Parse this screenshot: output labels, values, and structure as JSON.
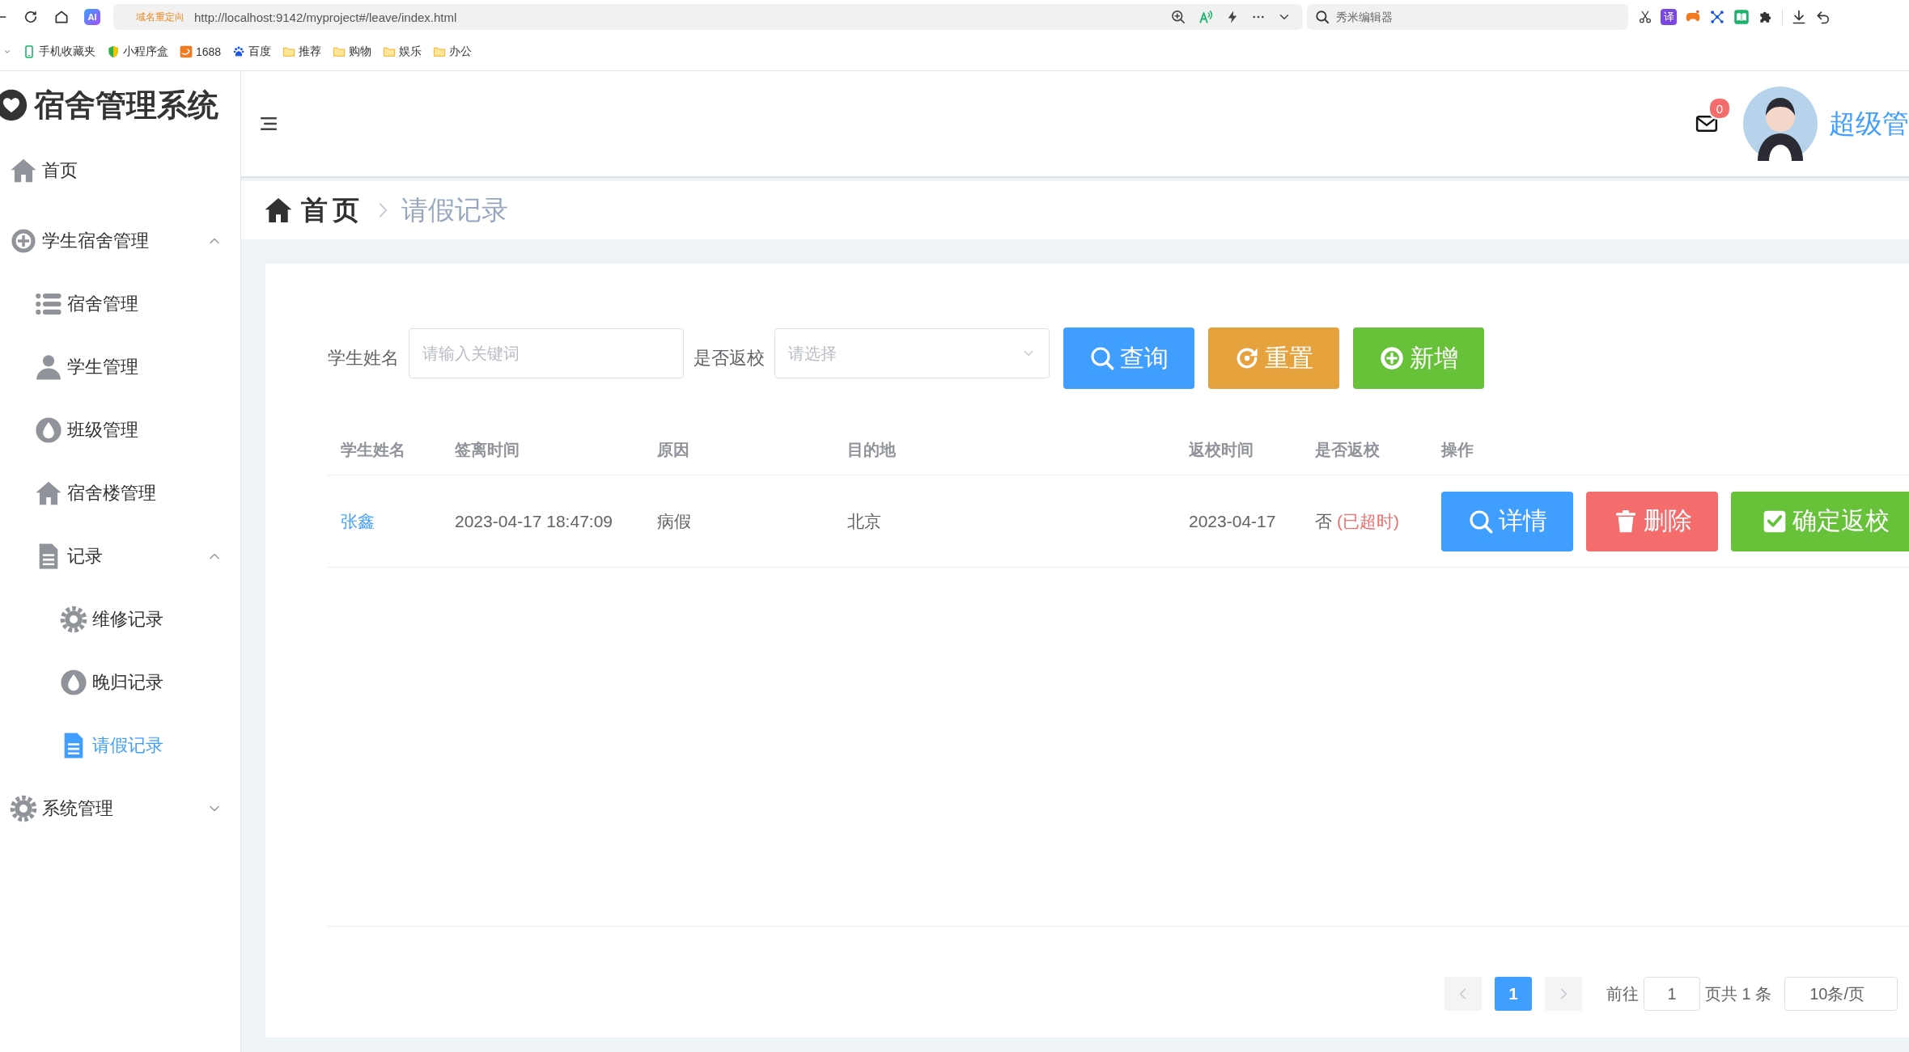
{
  "browser": {
    "ai_label": "AI",
    "redirect_label": "域名重定向",
    "url": "http://localhost:9142/myproject#/leave/index.html",
    "search_placeholder": "秀米编辑器",
    "translate_label": "译",
    "bookmarks": [
      {
        "label": "手机收藏夹",
        "kind": "phone"
      },
      {
        "label": "小程序盒",
        "kind": "shield"
      },
      {
        "label": "1688",
        "kind": "market"
      },
      {
        "label": "百度",
        "kind": "paw"
      },
      {
        "label": "推荐",
        "kind": "folder"
      },
      {
        "label": "购物",
        "kind": "folder"
      },
      {
        "label": "娱乐",
        "kind": "folder"
      },
      {
        "label": "办公",
        "kind": "folder"
      }
    ]
  },
  "sidebar": {
    "title": "宿舍管理系统",
    "items": [
      {
        "label": "首页",
        "kind": "home",
        "selected": false
      },
      {
        "label": "学生宿舍管理",
        "kind": "plus",
        "selected": false,
        "expanded": true,
        "children": [
          {
            "label": "宿舍管理",
            "kind": "list",
            "selected": false
          },
          {
            "label": "学生管理",
            "kind": "person",
            "selected": false
          },
          {
            "label": "班级管理",
            "kind": "drop",
            "selected": false
          },
          {
            "label": "宿舍楼管理",
            "kind": "home",
            "selected": false
          },
          {
            "label": "记录",
            "kind": "doc",
            "selected": false,
            "expanded": true,
            "children": [
              {
                "label": "维修记录",
                "kind": "gear",
                "selected": false
              },
              {
                "label": "晚归记录",
                "kind": "drop",
                "selected": false
              },
              {
                "label": "请假记录",
                "kind": "doc",
                "selected": true
              }
            ]
          }
        ]
      },
      {
        "label": "系统管理",
        "kind": "gear",
        "selected": false,
        "expanded": false
      }
    ]
  },
  "header": {
    "mail_badge": "0",
    "user_name": "超级管"
  },
  "breadcrumb": [
    {
      "label": "首页"
    },
    {
      "label": "请假记录"
    }
  ],
  "filters": {
    "fields": [
      {
        "label": "学生姓名",
        "kind": "text",
        "placeholder": "请输入关键词"
      },
      {
        "label": "是否返校",
        "kind": "select",
        "placeholder": "请选择"
      }
    ],
    "buttons": [
      {
        "label": "查询",
        "kind": "search"
      },
      {
        "label": "重置",
        "kind": "reset"
      },
      {
        "label": "新增",
        "kind": "add"
      }
    ]
  },
  "table": {
    "columns": [
      "学生姓名",
      "签离时间",
      "原因",
      "目的地",
      "返校时间",
      "是否返校",
      "操作"
    ],
    "rows": [
      {
        "name": "张鑫",
        "leave_time": "2023-04-17 18:47:09",
        "reason": "病假",
        "destination": "北京",
        "return_time": "2023-04-17",
        "returned": "否",
        "overdue": "(已超时)",
        "actions": [
          {
            "label": "详情",
            "kind": "detail"
          },
          {
            "label": "删除",
            "kind": "delete"
          },
          {
            "label": "确定返校",
            "kind": "confirm"
          }
        ]
      }
    ]
  },
  "pagination": {
    "prev_disabled": true,
    "next_disabled": true,
    "pages": [
      {
        "label": "1",
        "selected": true
      }
    ],
    "goto_label": "前往",
    "goto_value": "1",
    "total_label": "页共 1 条",
    "page_size": "10条/页"
  }
}
